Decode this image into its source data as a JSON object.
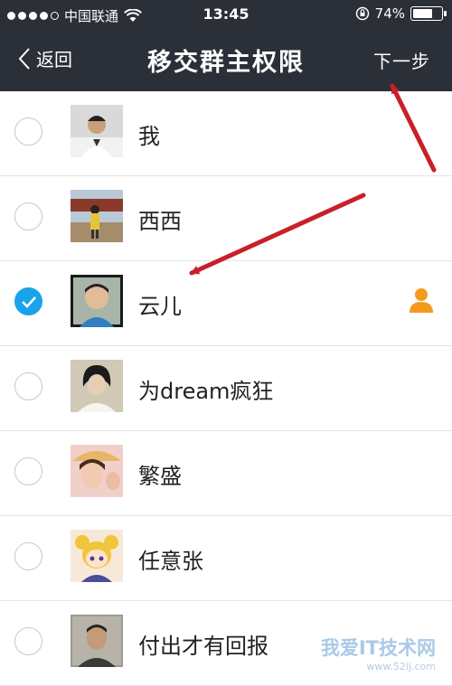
{
  "status_bar": {
    "carrier": "中国联通",
    "time": "13:45",
    "battery": "74%",
    "battery_level": 0.74,
    "icons": [
      "signal-dots-icon",
      "wifi-icon",
      "rotation-lock-icon",
      "battery-icon"
    ]
  },
  "nav": {
    "back_label": "返回",
    "title": "移交群主权限",
    "next_label": "下一步"
  },
  "members": [
    {
      "name": "我",
      "selected": false,
      "is_owner": false
    },
    {
      "name": "西西",
      "selected": false,
      "is_owner": false
    },
    {
      "name": "云儿",
      "selected": true,
      "is_owner": true
    },
    {
      "name": "为dream疯狂",
      "selected": false,
      "is_owner": false
    },
    {
      "name": "繁盛",
      "selected": false,
      "is_owner": false
    },
    {
      "name": "任意张",
      "selected": false,
      "is_owner": false
    },
    {
      "name": "付出才有回报",
      "selected": false,
      "is_owner": false
    }
  ],
  "watermark": {
    "text": "我爱IT技术网",
    "url": "www.52ij.com"
  },
  "colors": {
    "nav_bg": "#2b2f38",
    "check": "#1aa3ea",
    "owner_icon": "#f39a1e",
    "annotation_arrow": "#c8202a"
  }
}
